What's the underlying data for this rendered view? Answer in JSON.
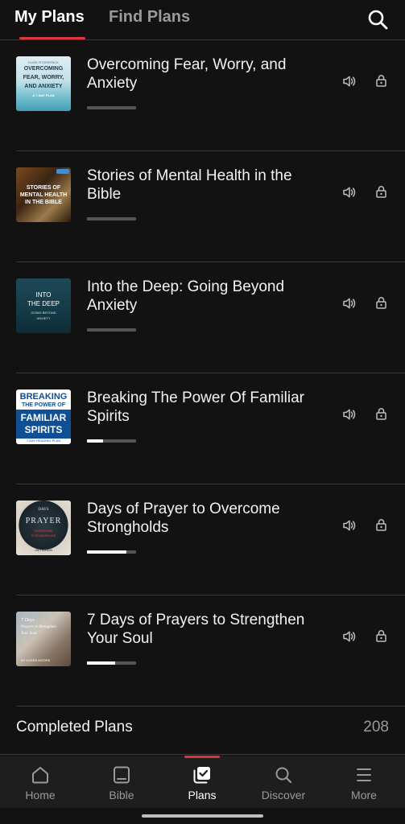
{
  "header": {
    "tabs": [
      {
        "label": "My Plans",
        "active": true
      },
      {
        "label": "Find Plans",
        "active": false
      }
    ],
    "search_icon": "search-icon",
    "accent_color": "#e0343f"
  },
  "plans": [
    {
      "title": "Overcoming Fear, Worry, and Anxiety",
      "progress": 0,
      "thumb_text": [
        "ELISE FITZPATRICK",
        "OVERCOMING",
        "FEAR, WORRY,",
        "AND ANXIETY",
        "A 7-DAY PLAN"
      ]
    },
    {
      "title": "Stories of Mental Health in the Bible",
      "progress": 0,
      "thumb_text": [
        "STORIES OF",
        "MENTAL HEALTH",
        "IN THE BIBLE"
      ]
    },
    {
      "title": "Into the Deep: Going Beyond Anxiety",
      "progress": 0,
      "thumb_text": [
        "INTO",
        "THE DEEP",
        "GOING BEYOND",
        "ANXIETY"
      ]
    },
    {
      "title": "Breaking The Power Of Familiar Spirits",
      "progress": 0.33,
      "thumb_text": [
        "BREAKING",
        "THE POWER OF",
        "FAMILIAR",
        "SPIRITS",
        "7 DAY READING PLAN"
      ]
    },
    {
      "title": "Days of Prayer to Overcome Strongholds",
      "progress": 0.8,
      "thumb_text": [
        "DAYS",
        "PRAYER",
        "OVERCOME",
        "STRONGHOLDS",
        "JIM HANKIN"
      ]
    },
    {
      "title": "7 Days of Prayers to Strengthen Your Soul",
      "progress": 0.57,
      "thumb_text": [
        "7 Days",
        "Prayers to Strengthen",
        "Your Soul",
        "BY KAREN MOORE"
      ]
    }
  ],
  "completed": {
    "label": "Completed Plans",
    "count": "208"
  },
  "nav": [
    {
      "label": "Home",
      "icon": "home-icon",
      "active": false
    },
    {
      "label": "Bible",
      "icon": "bible-icon",
      "active": false
    },
    {
      "label": "Plans",
      "icon": "plans-icon",
      "active": true
    },
    {
      "label": "Discover",
      "icon": "discover-icon",
      "active": false
    },
    {
      "label": "More",
      "icon": "menu-icon",
      "active": false
    }
  ]
}
